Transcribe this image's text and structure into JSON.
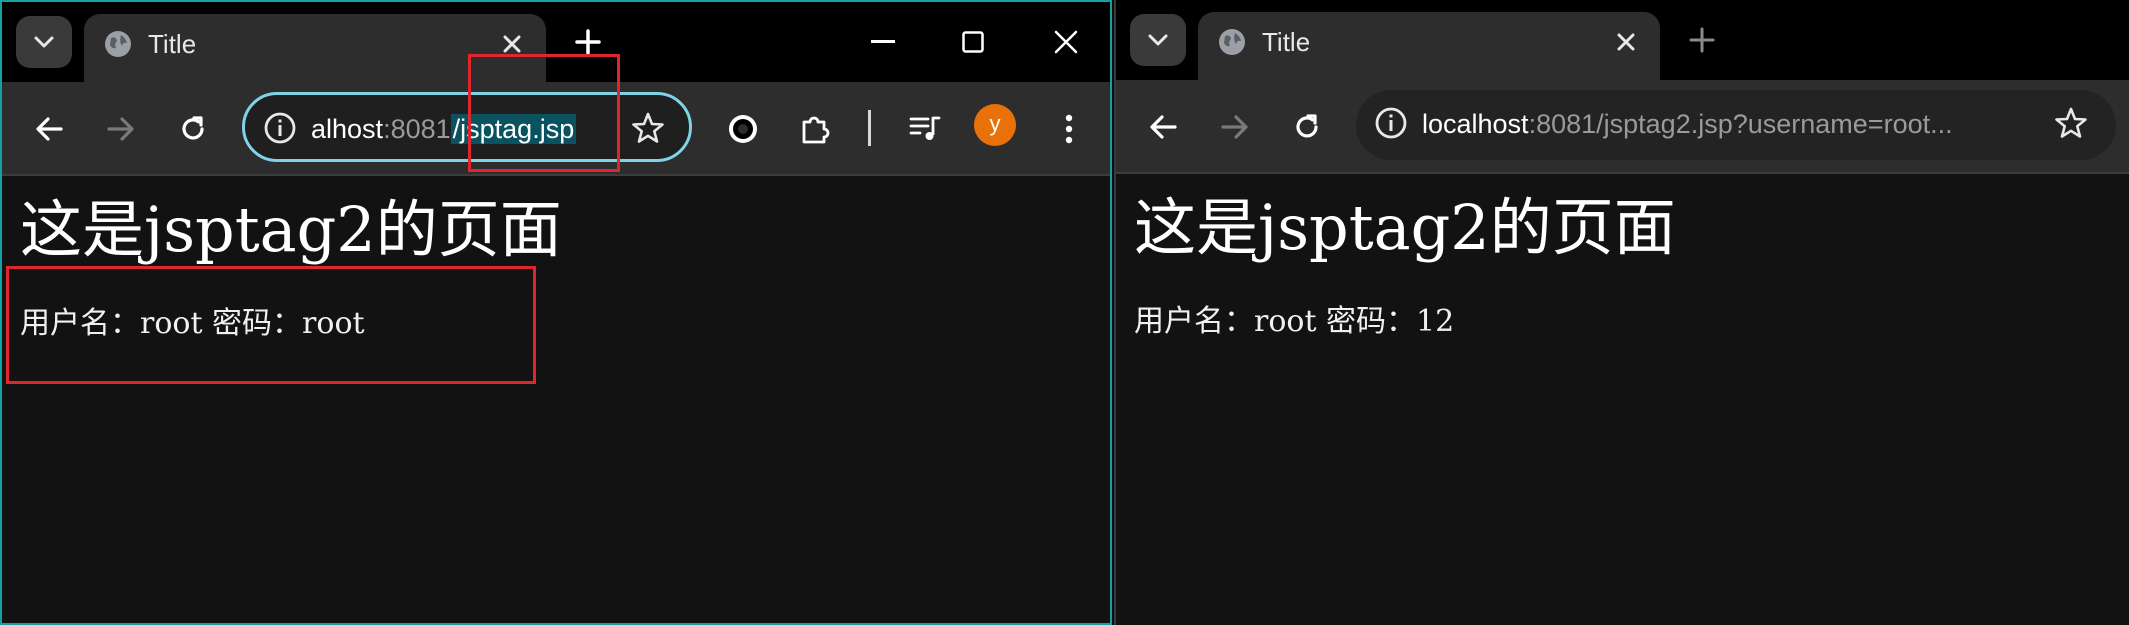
{
  "left": {
    "tab_title": "Title",
    "address": {
      "prefix": "alhost",
      "port": ":8081",
      "path": "/jsptag.jsp"
    },
    "avatar_letter": "y",
    "page": {
      "heading": "这是jsptag2的页面",
      "line": "用户名：root 密码：root"
    }
  },
  "right": {
    "tab_title": "Title",
    "address": {
      "host": "localhost",
      "rest": ":8081/jsptag2.jsp?username=root..."
    },
    "page": {
      "heading": "这是jsptag2的页面",
      "line": "用户名：root 密码：12"
    }
  },
  "colors": {
    "accent_outline": "#7fd3e6",
    "annotation_red": "#e0262c",
    "avatar": "#e8710a",
    "selection": "#0b5260"
  }
}
